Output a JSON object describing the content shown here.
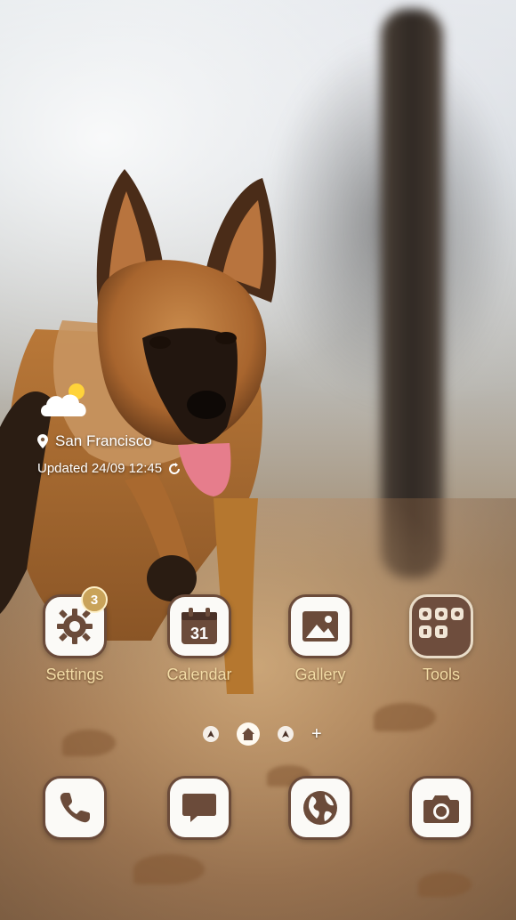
{
  "weather": {
    "location": "San Francisco",
    "updated": "Updated 24/09 12:45",
    "icon": "partly-sunny-icon"
  },
  "apps": [
    {
      "label": "Settings",
      "icon": "gear-icon",
      "badge": "3"
    },
    {
      "label": "Calendar",
      "icon": "calendar-icon",
      "date": "31"
    },
    {
      "label": "Gallery",
      "icon": "image-icon"
    },
    {
      "label": "Tools",
      "icon": "folder-grid-icon"
    }
  ],
  "dock": [
    {
      "icon": "phone-icon"
    },
    {
      "icon": "message-icon"
    },
    {
      "icon": "globe-icon"
    },
    {
      "icon": "camera-icon"
    }
  ],
  "pager": {
    "symbols": [
      "nav-dot",
      "home",
      "nav-dot",
      "add"
    ]
  },
  "colors": {
    "icon_border": "#6b4b3a",
    "icon_bg": "#fbfaf7",
    "label": "#f3dca6",
    "badge": "#c9a35a",
    "tools_bg": "#6e4d3d"
  }
}
